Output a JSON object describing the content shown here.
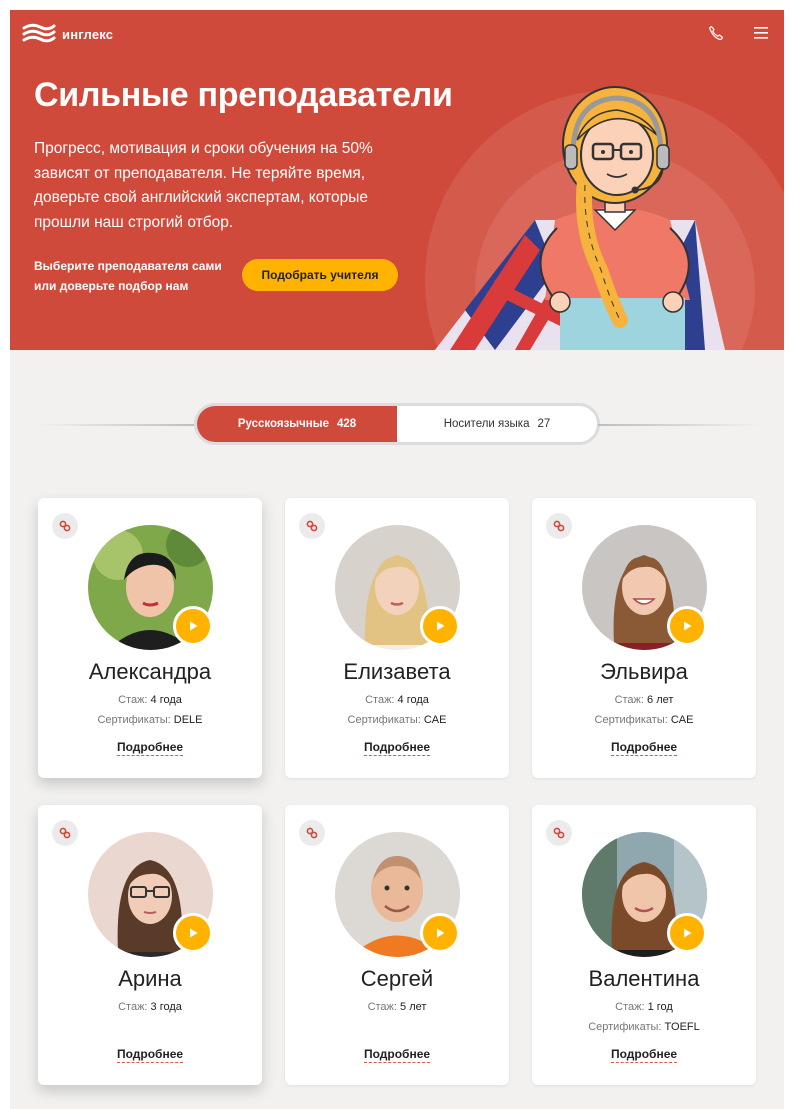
{
  "header": {
    "logo_text": "инглекс",
    "phone_icon": "phone-icon",
    "menu_icon": "hamburger-menu-icon"
  },
  "hero": {
    "title": "Сильные преподаватели",
    "subtitle": "Прогресс, мотивация и сроки обучения на 50% зависят от преподавателя. Не теряйте время, доверьте свой английский экспертам, которые прошли наш строгий отбор.",
    "cta_text": "Выберите преподавателя сами или доверьте подбор нам",
    "cta_button": "Подобрать учителя"
  },
  "tabs": [
    {
      "label": "Русскоязычные",
      "count": "428",
      "active": true
    },
    {
      "label": "Носители языка",
      "count": "27",
      "active": false
    }
  ],
  "teachers": [
    {
      "name": "Александра",
      "experience_label": "Стаж:",
      "experience": "4 года",
      "cert_label": "Сертификаты:",
      "cert": "DELE",
      "more": "Подробнее"
    },
    {
      "name": "Елизавета",
      "experience_label": "Стаж:",
      "experience": "4 года",
      "cert_label": "Сертификаты:",
      "cert": "CAE",
      "more": "Подробнее"
    },
    {
      "name": "Эльвира",
      "experience_label": "Стаж:",
      "experience": "6 лет",
      "cert_label": "Сертификаты:",
      "cert": "CAE",
      "more": "Подробнее"
    },
    {
      "name": "Арина",
      "experience_label": "Стаж:",
      "experience": "3 года",
      "cert_label": "",
      "cert": "",
      "more": "Подробнее"
    },
    {
      "name": "Сергей",
      "experience_label": "Стаж:",
      "experience": "5 лет",
      "cert_label": "",
      "cert": "",
      "more": "Подробнее"
    },
    {
      "name": "Валентина",
      "experience_label": "Стаж:",
      "experience": "1 год",
      "cert_label": "Сертификаты:",
      "cert": "TOEFL",
      "more": "Подробнее"
    }
  ],
  "colors": {
    "brand_red": "#cf4a3b",
    "accent_yellow": "#ffb300",
    "background": "#f2f1ef"
  },
  "icons": {
    "card_link": "link-icon",
    "card_play": "play-icon"
  }
}
